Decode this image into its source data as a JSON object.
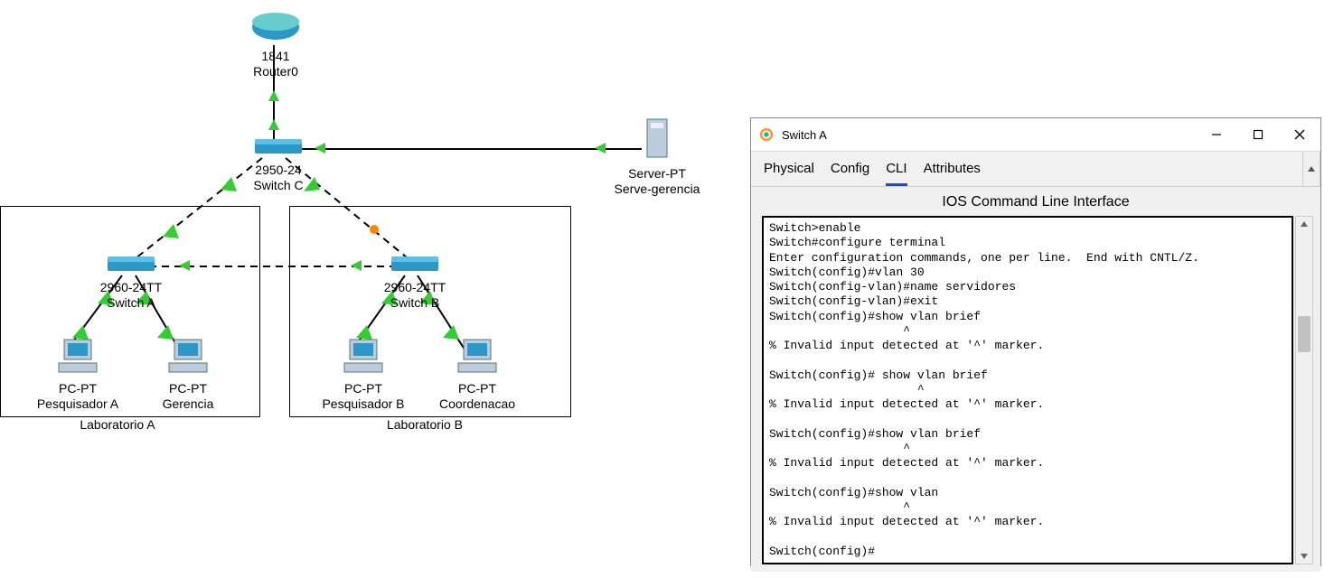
{
  "topology": {
    "router": {
      "model": "1841",
      "name": "Router0"
    },
    "switchC": {
      "model": "2950-24",
      "name": "Switch C"
    },
    "switchA": {
      "model": "2960-24TT",
      "name": "Switch A"
    },
    "switchB": {
      "model": "2960-24TT",
      "name": "Switch B"
    },
    "server": {
      "model": "Server-PT",
      "name": "Serve-gerencia"
    },
    "pc_pesqA": {
      "model": "PC-PT",
      "name": "Pesquisador A"
    },
    "pc_ger": {
      "model": "PC-PT",
      "name": "Gerencia"
    },
    "pc_pesqB": {
      "model": "PC-PT",
      "name": "Pesquisador B"
    },
    "pc_coord": {
      "model": "PC-PT",
      "name": "Coordenacao"
    },
    "labA": "Laboratorio A",
    "labB": "Laboratorio B"
  },
  "dialog": {
    "title": "Switch A",
    "tabs": {
      "physical": "Physical",
      "config": "Config",
      "cli": "CLI",
      "attributes": "Attributes"
    },
    "active_tab": "cli",
    "cli_heading": "IOS Command Line Interface",
    "cli_lines": [
      "Switch>enable",
      "Switch#configure terminal",
      "Enter configuration commands, one per line.  End with CNTL/Z.",
      "Switch(config)#vlan 30",
      "Switch(config-vlan)#name servidores",
      "Switch(config-vlan)#exit",
      "Switch(config)#show vlan brief",
      "                   ^",
      "% Invalid input detected at '^' marker.",
      "\t",
      "Switch(config)# show vlan brief",
      "                     ^",
      "% Invalid input detected at '^' marker.",
      "\t",
      "Switch(config)#show vlan brief",
      "                   ^",
      "% Invalid input detected at '^' marker.",
      "\t",
      "Switch(config)#show vlan",
      "                   ^",
      "% Invalid input detected at '^' marker.",
      "\t",
      "Switch(config)#"
    ]
  }
}
